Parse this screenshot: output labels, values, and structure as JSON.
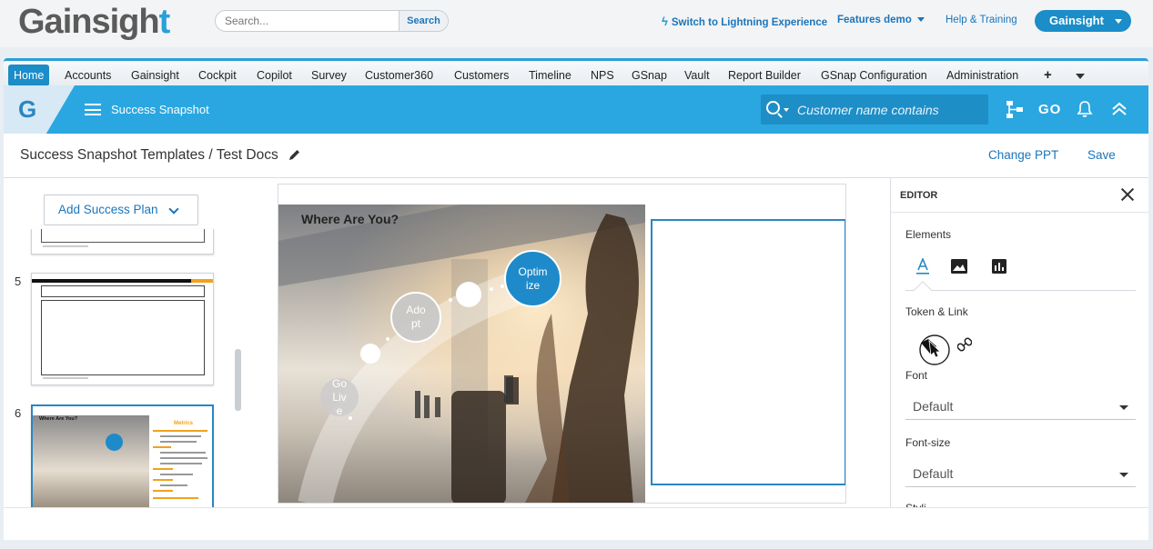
{
  "global": {
    "logo_text_main": "Gainsigh",
    "logo_text_accent": "t",
    "search_placeholder": "Search...",
    "search_button": "Search",
    "lightning_link": "Switch to Lightning Experience",
    "features_demo": "Features demo",
    "help_training": "Help & Training",
    "user_menu": "Gainsight"
  },
  "nav": {
    "tabs": [
      {
        "label": "Home",
        "active": true
      },
      {
        "label": "Accounts"
      },
      {
        "label": "Gainsight"
      },
      {
        "label": "Cockpit"
      },
      {
        "label": "Copilot"
      },
      {
        "label": "Survey"
      },
      {
        "label": "Customer360"
      },
      {
        "label": "Customers"
      },
      {
        "label": "Timeline"
      },
      {
        "label": "NPS"
      },
      {
        "label": "GSnap"
      },
      {
        "label": "Vault"
      },
      {
        "label": "Report Builder"
      },
      {
        "label": "GSnap Configuration"
      },
      {
        "label": "Administration"
      },
      {
        "label": "+"
      }
    ]
  },
  "app_header": {
    "badge_letter": "G",
    "title": "Success Snapshot",
    "customer_search_placeholder": "Customer name contains",
    "go_label": "GO",
    "icons": [
      "hierarchy-icon",
      "go-icon",
      "bell-icon",
      "collapse-up-icon"
    ]
  },
  "page": {
    "breadcrumb": "Success Snapshot Templates / Test Docs",
    "change_ppt": "Change PPT",
    "save": "Save"
  },
  "left_pane": {
    "add_success_plan": "Add Success Plan",
    "slides": [
      {
        "number": "5"
      },
      {
        "number": "6",
        "selected": true,
        "title": "Where Are You?",
        "side_heading": "Metrics"
      }
    ]
  },
  "slide": {
    "title": "Where Are You?",
    "stages": [
      "Go Live",
      "Adopt",
      "Optimize"
    ],
    "stage_lines": {
      "go_live": [
        "Go",
        "Liv",
        "e"
      ],
      "adopt": [
        "Ado",
        "pt"
      ],
      "optimize": [
        "Optim",
        "ize"
      ]
    }
  },
  "editor": {
    "title": "EDITOR",
    "elements_label": "Elements",
    "element_tabs": [
      "text-icon",
      "image-icon",
      "chart-icon"
    ],
    "token_link_label": "Token & Link",
    "font_label": "Font",
    "font_value": "Default",
    "font_size_label": "Font-size",
    "font_size_value": "Default",
    "style_label_partial": "Styli"
  },
  "colors": {
    "brand_blue": "#2aa7e0",
    "link_blue": "#1b75bb",
    "accent_circle": "#1e8ac9"
  }
}
